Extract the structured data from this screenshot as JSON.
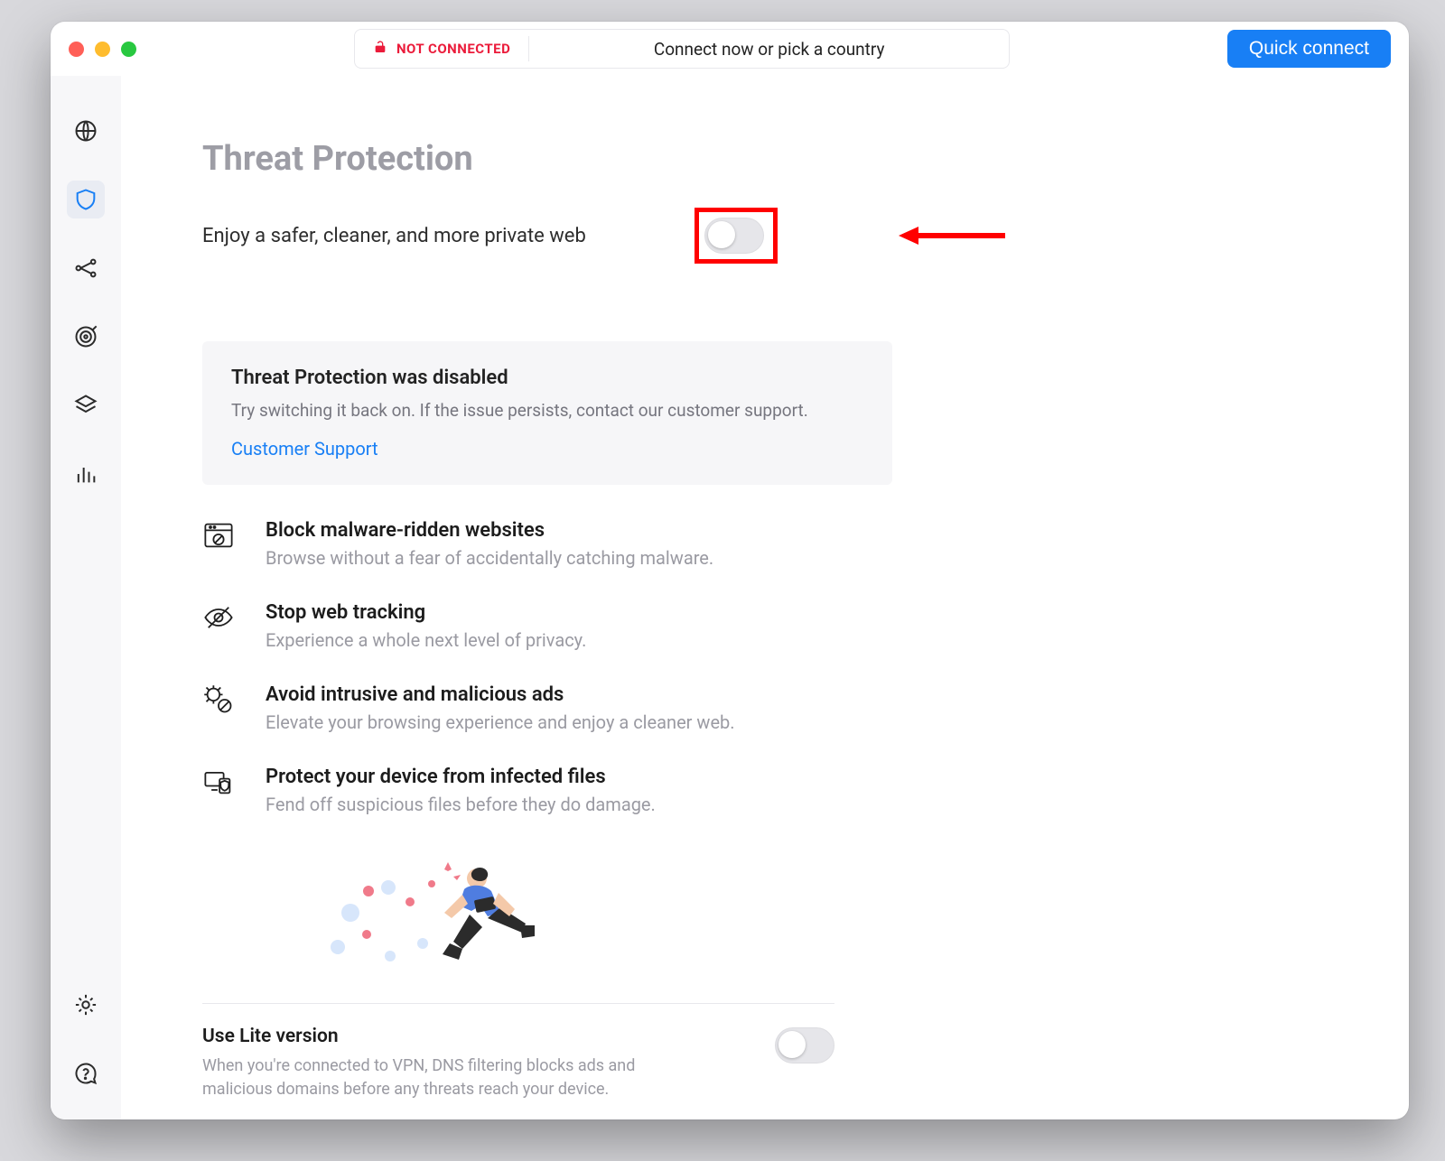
{
  "header": {
    "status_label": "NOT CONNECTED",
    "search_prompt": "Connect now or pick a country",
    "quick_connect_label": "Quick connect"
  },
  "sidebar": {
    "items": [
      {
        "id": "connection",
        "icon": "globe-icon"
      },
      {
        "id": "threat-protection",
        "icon": "shield-icon",
        "active": true
      },
      {
        "id": "meshnet",
        "icon": "network-icon"
      },
      {
        "id": "darkweb",
        "icon": "target-icon"
      },
      {
        "id": "presets",
        "icon": "layers-icon"
      },
      {
        "id": "stats",
        "icon": "bars-icon"
      }
    ],
    "bottom_items": [
      {
        "id": "settings",
        "icon": "gear-icon"
      },
      {
        "id": "help",
        "icon": "help-icon"
      }
    ]
  },
  "main": {
    "title": "Threat Protection",
    "subtitle": "Enjoy a safer, cleaner, and more private web",
    "threat_protection_toggle": false,
    "notice": {
      "title": "Threat Protection was disabled",
      "body": "Try switching it back on. If the issue persists, contact our customer support.",
      "link_label": "Customer Support"
    },
    "features": [
      {
        "icon": "browser-block-icon",
        "title": "Block malware-ridden websites",
        "desc": "Browse without a fear of accidentally catching malware."
      },
      {
        "icon": "eye-off-icon",
        "title": "Stop web tracking",
        "desc": "Experience a whole next level of privacy."
      },
      {
        "icon": "bug-block-icon",
        "title": "Avoid intrusive and malicious ads",
        "desc": "Elevate your browsing experience and enjoy a cleaner web."
      },
      {
        "icon": "devices-shield-icon",
        "title": "Protect your device from infected files",
        "desc": "Fend off suspicious files before they do damage."
      }
    ],
    "lite": {
      "title": "Use Lite version",
      "desc": "When you're connected to VPN, DNS filtering blocks ads and malicious domains before any threats reach your device.",
      "toggle": false
    }
  },
  "annotation": {
    "highlight_target": "threat-protection-toggle",
    "arrow_color": "#ff0000"
  },
  "colors": {
    "accent_blue": "#187ff5",
    "accent_red": "#eb1b3a",
    "title_grey": "#9d9da5",
    "text_grey": "#8d8d96"
  }
}
